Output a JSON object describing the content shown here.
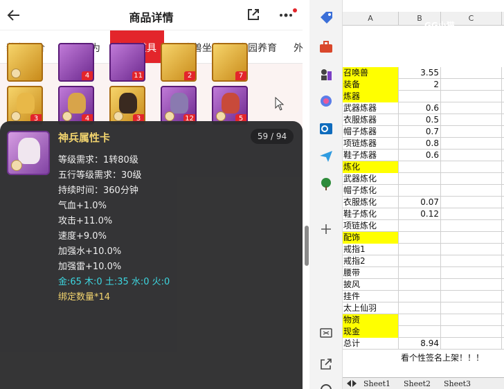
{
  "header": {
    "title": "商品详情"
  },
  "tabs": [
    "装备评价",
    "人物修为",
    "物品道具",
    "召唤兽坐骑",
    "家园养育",
    "外"
  ],
  "active_tab": 2,
  "grid": {
    "row1_badges": [
      "4",
      "11",
      "2",
      "7"
    ],
    "row2_badges": [
      "3",
      "4",
      "3",
      "12",
      "5"
    ]
  },
  "popup": {
    "name": "神兵属性卡",
    "count": "59 / 94",
    "stats": [
      "等级需求：1转80级",
      "五行等级需求：30级",
      "持续时间：360分钟",
      "气血+1.0%",
      "攻击+11.0%",
      "速度+9.0%",
      "加强水+10.0%",
      "加强雷+10.0%"
    ],
    "elements": "金:65 木:0 土:35 水:0 火:0",
    "bind": "绑定数量*14"
  },
  "sheet": {
    "columns": [
      "A",
      "B",
      "C"
    ],
    "watermark": "GG小猫",
    "rows": [
      {
        "a": "召唤兽",
        "b": "3.55",
        "hl": true
      },
      {
        "a": "装备",
        "b": "2",
        "hl": true
      },
      {
        "a": "炼器",
        "b": "",
        "hl": true
      },
      {
        "a": "武器炼器",
        "b": "0.6",
        "hl": false
      },
      {
        "a": "衣服炼器",
        "b": "0.5",
        "hl": false
      },
      {
        "a": "帽子炼器",
        "b": "0.7",
        "hl": false
      },
      {
        "a": "项链炼器",
        "b": "0.8",
        "hl": false
      },
      {
        "a": "鞋子炼器",
        "b": "0.6",
        "hl": false
      },
      {
        "a": "炼化",
        "b": "",
        "hl": true
      },
      {
        "a": "武器炼化",
        "b": "",
        "hl": false
      },
      {
        "a": "帽子炼化",
        "b": "",
        "hl": false
      },
      {
        "a": "衣服炼化",
        "b": "0.07",
        "hl": false
      },
      {
        "a": "鞋子炼化",
        "b": "0.12",
        "hl": false
      },
      {
        "a": "项链炼化",
        "b": "",
        "hl": false
      },
      {
        "a": "配饰",
        "b": "",
        "hl": true
      },
      {
        "a": "戒指1",
        "b": "",
        "hl": false
      },
      {
        "a": "戒指2",
        "b": "",
        "hl": false
      },
      {
        "a": "腰带",
        "b": "",
        "hl": false
      },
      {
        "a": "披风",
        "b": "",
        "hl": false
      },
      {
        "a": "挂件",
        "b": "",
        "hl": false
      },
      {
        "a": "太上仙羽",
        "b": "",
        "hl": false
      },
      {
        "a": "物资",
        "b": "",
        "hl": true
      },
      {
        "a": "现金",
        "b": "",
        "hl": true
      },
      {
        "a": "总计",
        "b": "8.94",
        "hl": false
      }
    ],
    "footer": "看个性签名上架！！！",
    "sheet_tabs": [
      "Sheet1",
      "Sheet2",
      "Sheet3"
    ]
  },
  "colors": {
    "accent": "#e3252b",
    "popup_bg": "#2e2e30",
    "name": "#f2d36a",
    "elements": "#37d6e0",
    "highlight": "#ffff00"
  },
  "icons": [
    "back-arrow-icon",
    "share-icon",
    "more-dots-icon",
    "tag-icon",
    "toolbox-icon",
    "chess-icon",
    "copilot-icon",
    "outlook-icon",
    "send-icon",
    "tree-icon",
    "plus-icon",
    "screenshot-icon",
    "open-external-icon",
    "settings-icon"
  ]
}
